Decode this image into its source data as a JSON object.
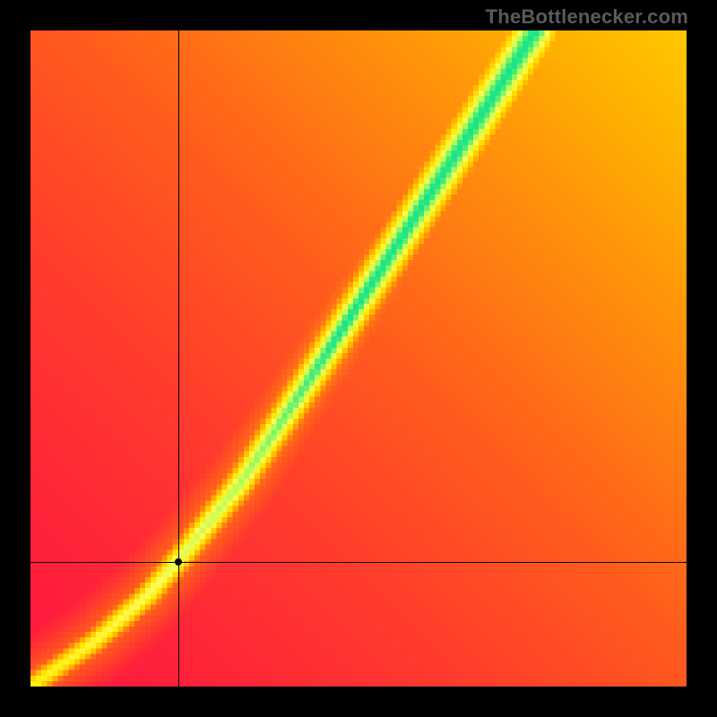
{
  "watermark": "TheBottlenecker.com",
  "chart_data": {
    "type": "heatmap",
    "title": "",
    "xlabel": "",
    "ylabel": "",
    "xlim": [
      0,
      1
    ],
    "ylim": [
      0,
      1
    ],
    "grid_resolution": 120,
    "marker": {
      "x": 0.225,
      "y": 0.19
    },
    "crosshair": {
      "x": 0.225,
      "y": 0.19
    },
    "colormap": [
      {
        "pos": 0.0,
        "color": "#ff173f"
      },
      {
        "pos": 0.3,
        "color": "#ff5a1d"
      },
      {
        "pos": 0.55,
        "color": "#ffb400"
      },
      {
        "pos": 0.72,
        "color": "#ffeb00"
      },
      {
        "pos": 0.82,
        "color": "#fff95a"
      },
      {
        "pos": 0.9,
        "color": "#b7ff52"
      },
      {
        "pos": 1.0,
        "color": "#17e38b"
      }
    ],
    "ridge": {
      "points": [
        {
          "x": 0.0,
          "y": 0.0
        },
        {
          "x": 0.1,
          "y": 0.07
        },
        {
          "x": 0.18,
          "y": 0.14
        },
        {
          "x": 0.24,
          "y": 0.21
        },
        {
          "x": 0.32,
          "y": 0.31
        },
        {
          "x": 0.42,
          "y": 0.46
        },
        {
          "x": 0.55,
          "y": 0.66
        },
        {
          "x": 0.68,
          "y": 0.86
        },
        {
          "x": 0.77,
          "y": 1.0
        }
      ],
      "base_width": 0.015,
      "width_growth": 1.2,
      "lobe_spread": 0.35,
      "lobe_strength": 0.55
    },
    "field_note": "Scalar field: value(x,y) in [0,1], 1 on the green ridge, decaying toward 0 (red) away from it. Ridge broadens toward upper right; slight wider yellow envelope flanks the green core."
  }
}
